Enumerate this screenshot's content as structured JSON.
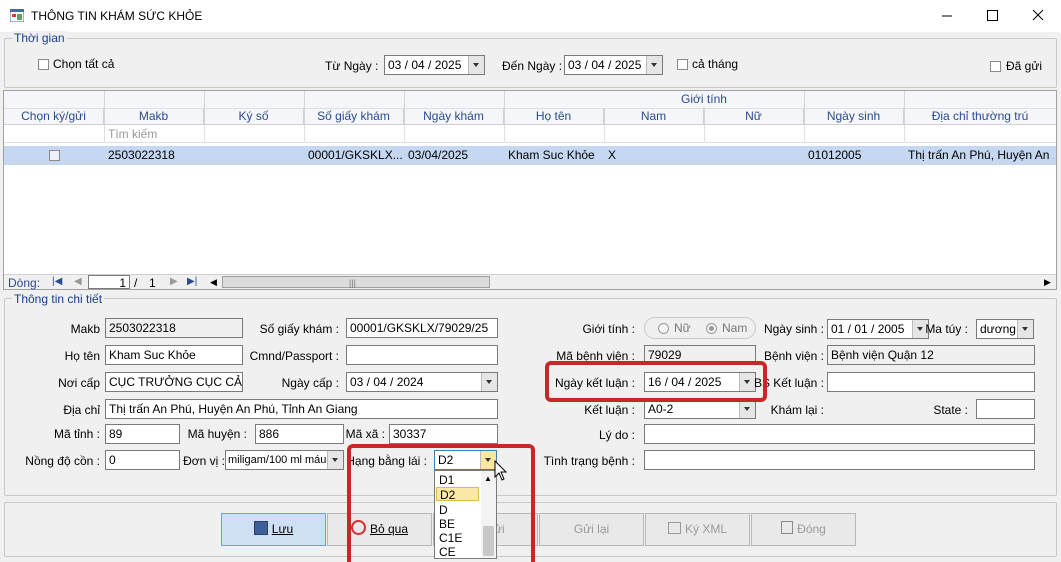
{
  "window": {
    "title": "THÔNG TIN KHÁM SỨC KHỎE"
  },
  "thoigian": {
    "group_label": "Thời gian",
    "chon_tat_ca": "Chọn tất cả",
    "tu_ngay_label": "Từ Ngày :",
    "tu_ngay_value": "03 / 04 / 2025",
    "den_ngay_label": "Đến Ngày :",
    "den_ngay_value": "03 / 04 / 2025",
    "ca_thang": "cả tháng",
    "da_gui": "Đã gửi"
  },
  "grid": {
    "group_header": "Giới tính",
    "columns": [
      "Chọn ký/gửi",
      "Makb",
      "Ký số",
      "Số giấy khám",
      "Ngày khám",
      "Họ tên",
      "Nam",
      "Nữ",
      "Ngày sinh",
      "Địa chỉ thường trú"
    ],
    "filter_placeholder": "Tìm kiếm",
    "rows": [
      {
        "makb": "2503022318",
        "kyso": "",
        "sogiay": "00001/GKSKLX...",
        "ngaykham": "03/04/2025",
        "hoten": "Kham Suc Khỏe",
        "nam": "X",
        "nu": "",
        "ngaysinh": "01012005",
        "diachi": "Thị trấn An Phú, Huyện An ..."
      }
    ],
    "pager": {
      "label": "Dòng:",
      "current": "1",
      "sep": "/",
      "total": "1",
      "scroll_grip": "|||"
    }
  },
  "detail": {
    "group_label": "Thông tin chi tiết",
    "makb_label": "Makb",
    "makb": "2503022318",
    "sogiaykham_label": "Số giấy khám :",
    "sogiaykham": "00001/GKSKLX/79029/25",
    "gioitinh_label": "Giới tính :",
    "nu": "Nữ",
    "nam": "Nam",
    "ngaysinh_label": "Ngày sinh :",
    "ngaysinh": "01 / 01 / 2005",
    "matuy_label": "Ma túy :",
    "matuy": "dương tí",
    "hoten_label": "Họ tên",
    "hoten": "Kham Suc Khỏe",
    "cmnd_label": "Cmnd/Passport :",
    "cmnd": "",
    "mabenhvien_label": "Mã bệnh viện :",
    "mabenhvien": "79029",
    "benhvien_label": "Bệnh viện :",
    "benhvien": "Bệnh viện Quận 12",
    "noicap_label": "Nơi cấp",
    "noicap": "CỤC TRƯỞNG CỤC CẢNH",
    "ngaycap_label": "Ngày cấp :",
    "ngaycap": "03 / 04 / 2024",
    "ngayketluan_label": "Ngày kết luận :",
    "ngayketluan": "16 / 04 / 2025",
    "bsketluan_label": "BS Kết luận :",
    "bsketluan": "",
    "diachi_label": "Địa chỉ",
    "diachi": "Thị trấn An Phú, Huyện An Phú, Tỉnh An Giang",
    "ketluan_label": "Kết luận :",
    "ketluan": "A0-2",
    "khamlai_label": "Khám lại :",
    "state_label": "State :",
    "state": "",
    "matinh_label": "Mã tỉnh :",
    "matinh": "89",
    "mahuyen_label": "Mã huyện :",
    "mahuyen": "886",
    "maxa_label": "Mã xã :",
    "maxa": "30337",
    "lydo_label": "Lý do :",
    "lydo": "",
    "nongdocon_label": "Nồng độ cồn :",
    "nongdocon": "0",
    "donvi_label": "Đơn vị :",
    "donvi": "miligam/100 ml máu",
    "hangbanglai_label": "Hạng bằng lái :",
    "hangbanglai": "D2",
    "tinhtrangbenh_label": "Tình trạng bệnh :",
    "tinhtrangbenh": ""
  },
  "hang_dropdown": {
    "options": [
      "D1",
      "D2",
      "D",
      "BE",
      "C1E",
      "CE"
    ],
    "selected": "D2"
  },
  "buttons": {
    "luu": "Lưu",
    "boqua": "Bỏ qua",
    "gui": "ửi",
    "guilai": "Gửi lại",
    "kyxml": "Ký XML",
    "dong": "Đóng"
  },
  "colors": {
    "highlight": "#c62828",
    "selected_row": "#c5d7f1",
    "label_blue": "#1a3c8a"
  }
}
